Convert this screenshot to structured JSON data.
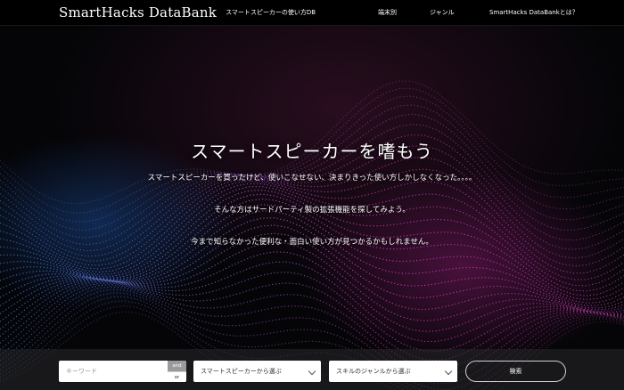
{
  "header": {
    "brand": "SmartHacks DataBank",
    "subtitle": "スマートスピーカーの使い方DB",
    "nav": [
      "端末別",
      "ジャンル",
      "SmartHacks DataBankとは？"
    ]
  },
  "hero": {
    "title": "スマートスピーカーを嗜もう",
    "lines": [
      "スマートスピーカーを買ったけど、使いこなせない、決まりきった使い方しかしなくなった。。。。",
      "そんな方はサードパーティ製の拡張機能を探してみよう。",
      "今まで知らなかった便利な・面白い使い方が見つかるかもしれません。"
    ]
  },
  "search": {
    "keyword_placeholder": "キーワード",
    "and_label": "and",
    "or_label": "or",
    "speaker_select": "スマートスピーカーから選ぶ",
    "genre_select": "スキルのジャンルから選ぶ",
    "submit_label": "検索"
  },
  "colors": {
    "background": "#050508",
    "wave_pink": "#e040c0",
    "wave_blue": "#3a7be0"
  }
}
